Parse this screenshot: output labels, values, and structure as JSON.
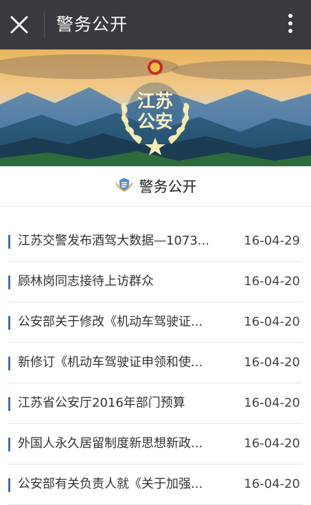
{
  "header": {
    "title": "警务公开"
  },
  "banner": {
    "emblem_text_top": "江苏",
    "emblem_text_bottom": "公安"
  },
  "section": {
    "title": "警务公开"
  },
  "items": [
    {
      "title": "江苏交警发布酒驾大数据—1073...",
      "date": "16-04-29"
    },
    {
      "title": "顾林岗同志接待上访群众",
      "date": "16-04-20"
    },
    {
      "title": "公安部关于修改《机动车驾驶证...",
      "date": "16-04-20"
    },
    {
      "title": "新修订《机动车驾驶证申领和使...",
      "date": "16-04-20"
    },
    {
      "title": "江苏省公安厅2016年部门预算",
      "date": "16-04-20"
    },
    {
      "title": "外国人永久居留制度新思想新政...",
      "date": "16-04-20"
    },
    {
      "title": "公安部有关负责人就《关于加强...",
      "date": "16-04-20"
    }
  ]
}
